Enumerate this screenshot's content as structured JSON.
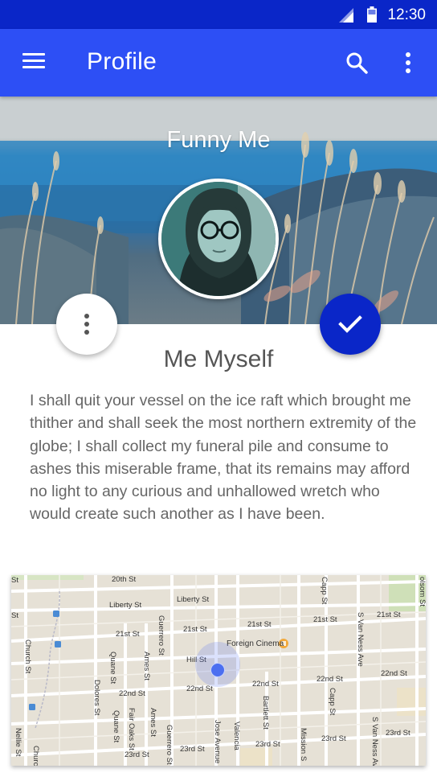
{
  "status_bar": {
    "time": "12:30",
    "icons": [
      "signal-icon",
      "battery-icon"
    ]
  },
  "app_bar": {
    "title": "Profile",
    "icons": [
      "menu-icon",
      "search-icon",
      "more-vert-icon"
    ]
  },
  "header": {
    "title": "Funny Me"
  },
  "profile": {
    "name": "Me Myself",
    "bio": "I shall quit your vessel on the ice raft which brought me thither and shall seek the most northern extremity of the globe; I shall collect my funeral pile and consume to ashes this miserable frame, that its remains may afford no light to any curious and unhallowed wretch who would create such another as I have been."
  },
  "actions": {
    "more_icon": "more-vert-icon",
    "confirm_icon": "check-icon"
  },
  "map": {
    "streets": {
      "liberty_1": "Liberty St",
      "liberty_2": "Liberty St",
      "st_21_1": "21st St",
      "st_21_2": "21st St",
      "st_21_3": "21st St",
      "st_21_4": "21st St",
      "st_21_5": "21st St",
      "hill": "Hill St",
      "st_22_1": "22nd St",
      "st_22_2": "22nd St",
      "st_22_3": "22nd St",
      "st_22_4": "22nd St",
      "st_22_5": "22nd St",
      "st_23_1": "23rd St",
      "st_23_2": "23rd St",
      "st_23_3": "23rd St",
      "st_23_4": "23rd St",
      "st_23_5": "23rd St",
      "st_20": "20th St",
      "church": "Church St",
      "dolores": "Dolores St",
      "guerrero_1": "Guerrero St",
      "guerrero_2": "Guerrero St",
      "quane_1": "Quane St",
      "quane_2": "Quane St",
      "ames": "Ames St",
      "fair_oaks": "Fair Oaks St",
      "jose": "Jose Avenue",
      "valencia": "Valencia",
      "bartlett": "Bartlett St",
      "mission": "Mission S",
      "capp_1": "Capp St",
      "capp_2": "Capp St",
      "van_ness_1": "S Van Ness Ave",
      "van_ness_2": "S Van Ness Ave",
      "folsom": "olsom St",
      "nellie": "Nellie St",
      "chur": "Churc",
      "st_left": "St",
      "st_left2": "St"
    },
    "poi": "Foreign Cinema",
    "location_marker": "location-dot"
  }
}
